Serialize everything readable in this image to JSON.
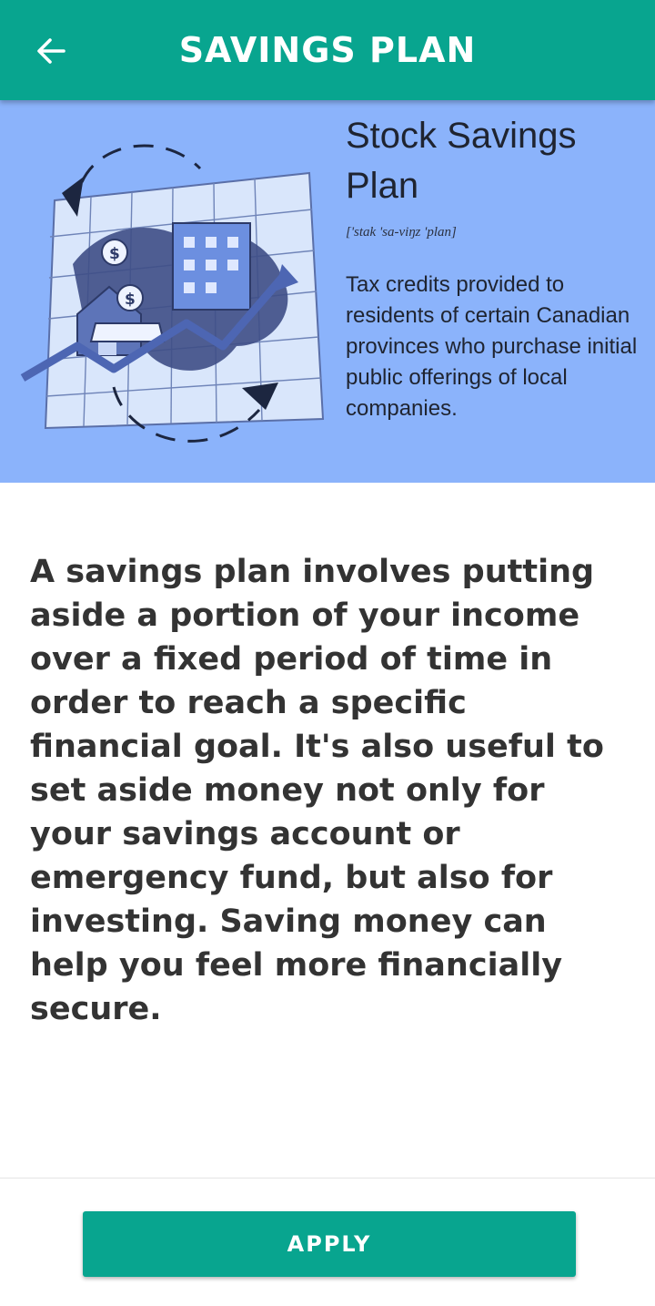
{
  "header": {
    "title": "SAVINGS PLAN",
    "back_icon": "arrow-left-icon",
    "background_color": "#08a58f"
  },
  "banner": {
    "heading": "Stock Savings Plan",
    "pronunciation": "['stak 'sa-viŋz 'plan]",
    "definition": "Tax credits provided to residents of certain Canadian provinces who purchase initial public offerings of local companies.",
    "background_color": "#8bb3fb"
  },
  "content": {
    "body": "A savings plan involves putting aside a portion of your income over a fixed period of time in order to reach a specific financial goal. It's also useful to set aside money not only for your savings account or emergency fund, but also for investing. Saving money can help you feel more financially secure."
  },
  "footer": {
    "apply_label": "APPLY"
  }
}
